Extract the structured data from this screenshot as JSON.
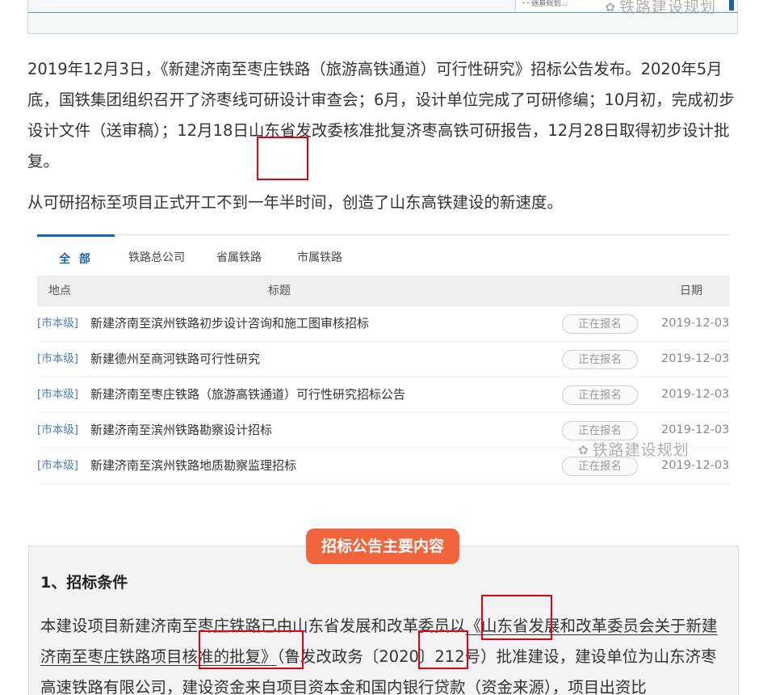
{
  "watermark": {
    "icon": "wechat-icon",
    "text": "铁路建设规划"
  },
  "top_image": {
    "legend_text": "远景规划..."
  },
  "article": {
    "paragraph1": "2019年12月3日，《新建济南至枣庄铁路（旅游高铁通道）可行性研究》招标公告发布。2020年5月底，国铁集团组织召开了济枣线可研设计审查会；6月，设计单位完成了可研修编；10月初，完成初步设计文件（送审稿）；12月18日山东省发改委核准批复济枣高铁可研报告，12月28日取得初步设计批复。",
    "paragraph2": "从可研招标至项目正式开工不到一年半时间，创造了山东高铁建设的新速度。"
  },
  "tender_table": {
    "tabs": [
      "全 部",
      "铁路总公司",
      "省属铁路",
      "市属铁路"
    ],
    "columns": {
      "location": "地点",
      "title": "标题",
      "date": "日期"
    },
    "rows": [
      {
        "location": "[市本级]",
        "title": "新建济南至滨州铁路初步设计咨询和施工图审核招标",
        "status": "正在报名",
        "date": "2019-12-03"
      },
      {
        "location": "[市本级]",
        "title": "新建德州至商河铁路可行性研究",
        "status": "正在报名",
        "date": "2019-12-03"
      },
      {
        "location": "[市本级]",
        "title": "新建济南至枣庄铁路（旅游高铁通道）可行性研究招标公告",
        "status": "正在报名",
        "date": "2019-12-03"
      },
      {
        "location": "[市本级]",
        "title": "新建济南至滨州铁路勘察设计招标",
        "status": "正在报名",
        "date": "2019-12-03"
      },
      {
        "location": "[市本级]",
        "title": "新建济南至滨州铁路地质勘察监理招标",
        "status": "正在报名",
        "date": "2019-12-03"
      }
    ]
  },
  "section_badge": "招标公告主要内容",
  "notice": {
    "heading": "1、招标条件",
    "body_plain_1": "本建设项目新建济南至枣庄铁路已由山东省发展和改革委员以",
    "body_link": "《山东省发展和改革委员会关于新建济南至枣庄铁路项目核准的批复》",
    "body_plain_2": "（鲁发改政务〔2020〕212号）",
    "body_plain_3": "批准建设，建设单位为山东济枣高速铁路有限公司，建设资金来自项目资本金和国内银行贷款（资金来源），项目出资比"
  },
  "colors": {
    "highlight_red": "#e60012",
    "badge_orange": "#f2643c",
    "tab_blue": "#1a64b4",
    "location_blue": "#4a7cc0"
  }
}
